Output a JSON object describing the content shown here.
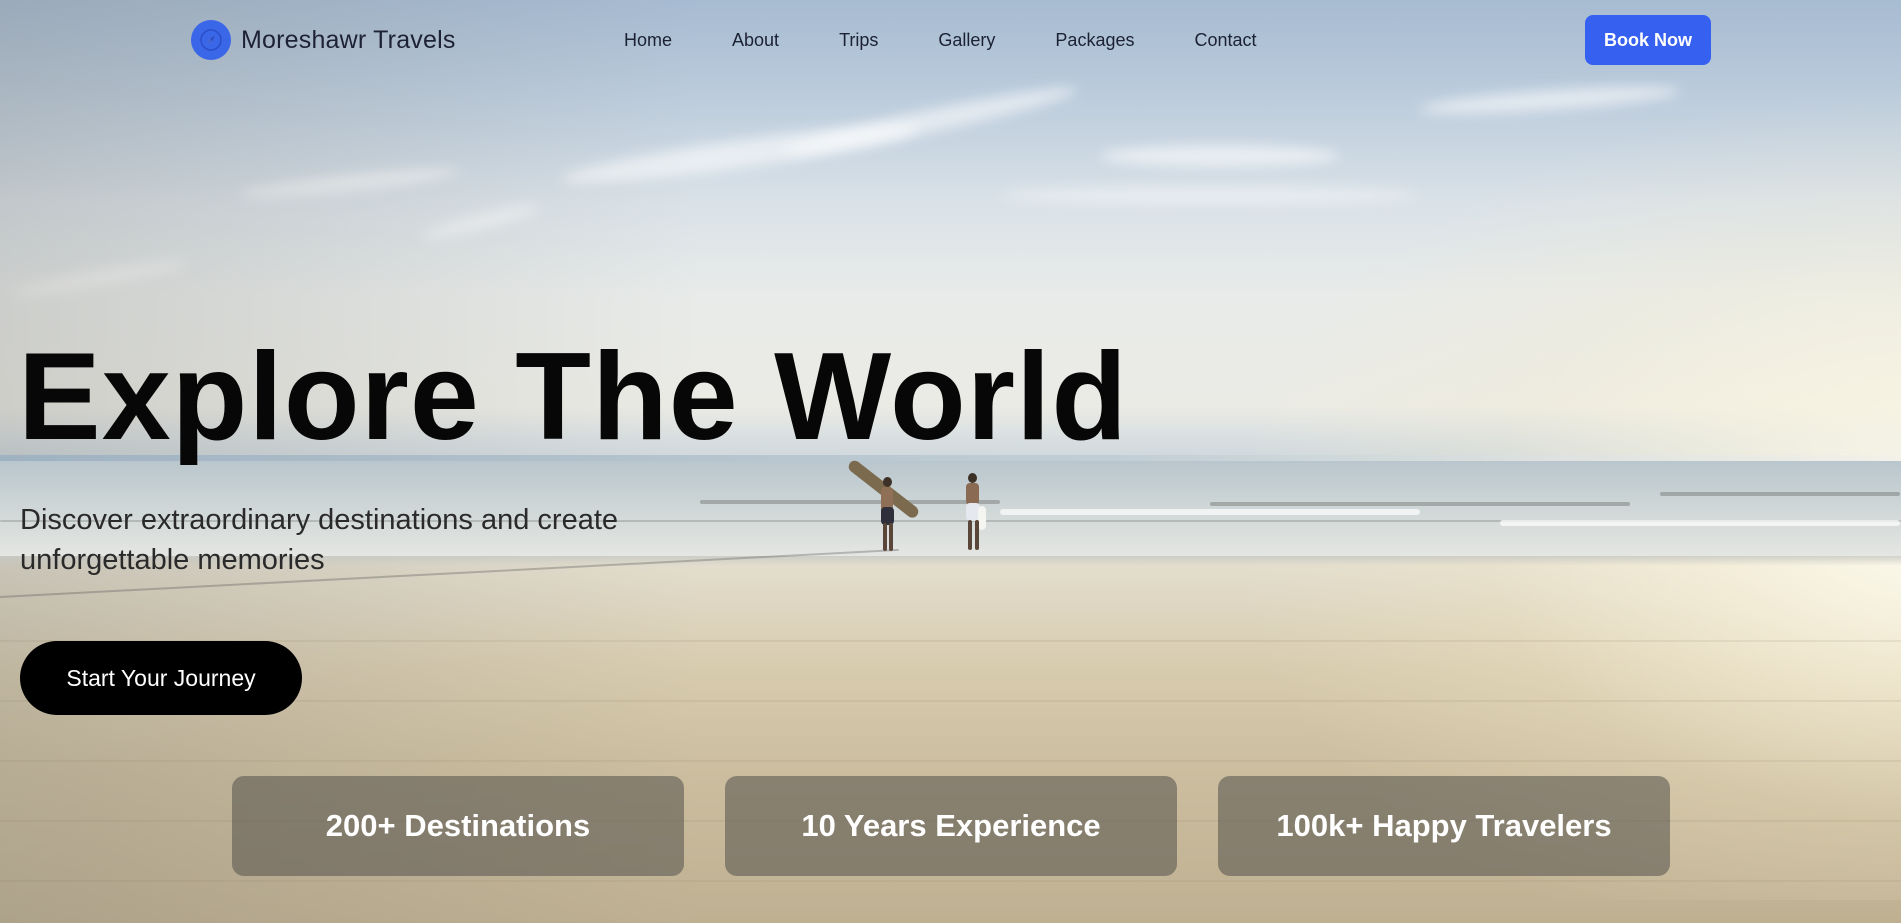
{
  "brand": {
    "name": "Moreshawr Travels",
    "icon": "compass-icon",
    "accent_color": "#3a66e8"
  },
  "nav": {
    "links": [
      {
        "label": "Home"
      },
      {
        "label": "About"
      },
      {
        "label": "Trips"
      },
      {
        "label": "Gallery"
      },
      {
        "label": "Packages"
      },
      {
        "label": "Contact"
      }
    ],
    "cta_label": "Book Now",
    "cta_color": "#3660f0"
  },
  "hero": {
    "title": "Explore The World",
    "subtitle": "Discover extraordinary destinations and create unforgettable memories",
    "cta_label": "Start Your Journey",
    "background": "beach-with-surfers-image"
  },
  "stats": [
    {
      "label": "200+ Destinations"
    },
    {
      "label": "10 Years Experience"
    },
    {
      "label": "100k+ Happy Travelers"
    }
  ]
}
